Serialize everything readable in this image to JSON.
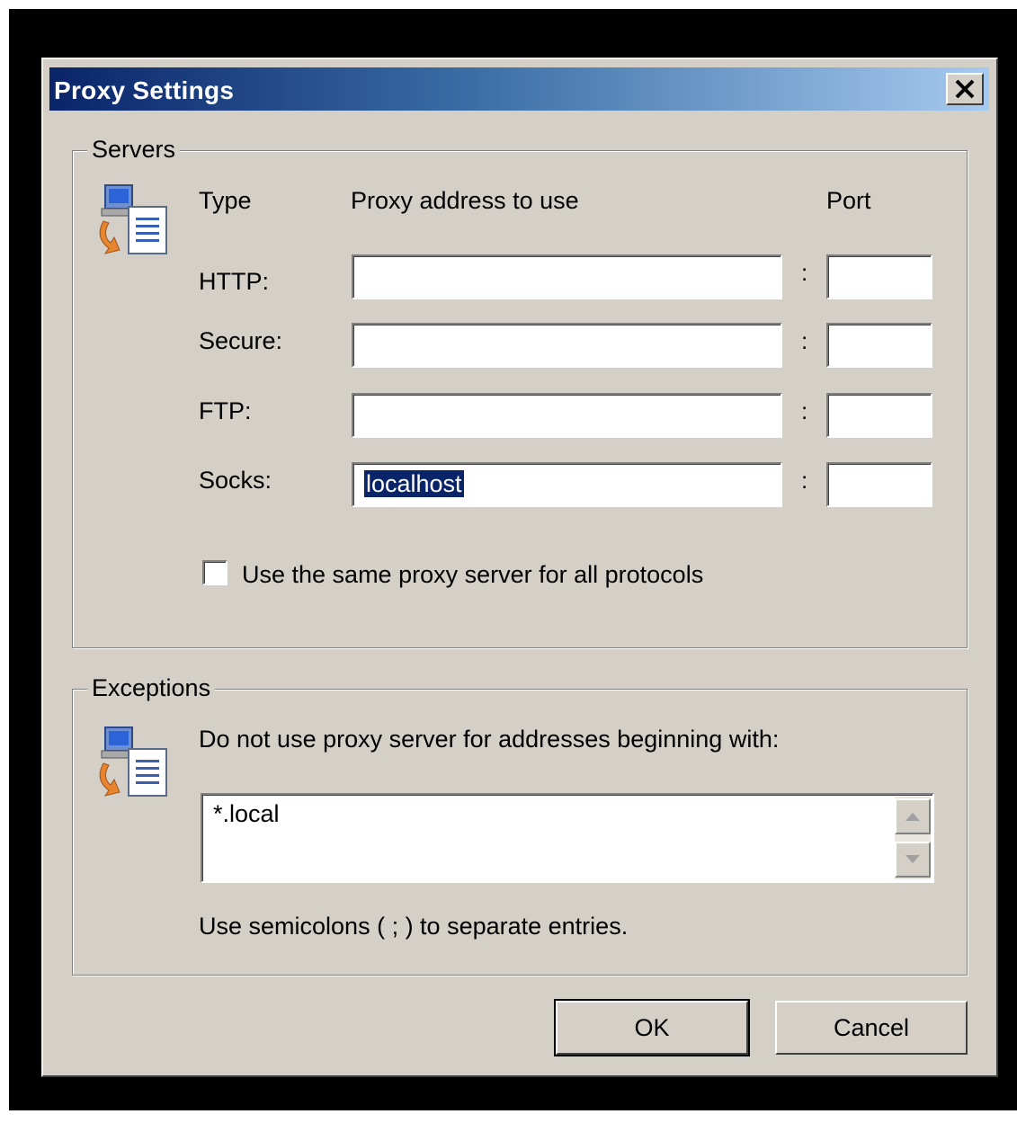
{
  "dialog": {
    "title": "Proxy Settings",
    "close_glyph": "✕"
  },
  "servers": {
    "legend": "Servers",
    "icon": "network-computer-icon",
    "headers": {
      "type": "Type",
      "address": "Proxy address to use",
      "port": "Port"
    },
    "rows": [
      {
        "label": "HTTP:",
        "address": "",
        "port": "",
        "colon": ":"
      },
      {
        "label": "Secure:",
        "address": "",
        "port": "",
        "colon": ":"
      },
      {
        "label": "FTP:",
        "address": "",
        "port": "",
        "colon": ":"
      },
      {
        "label": "Socks:",
        "address": "localhost",
        "port": "",
        "colon": ":"
      }
    ],
    "same_proxy_checkbox": {
      "label": "Use the same proxy server for all protocols",
      "checked": false
    }
  },
  "exceptions": {
    "legend": "Exceptions",
    "icon": "network-computer-icon",
    "instruction": "Do not use proxy server for addresses beginning with:",
    "value": "*.local",
    "hint": "Use semicolons ( ; ) to separate entries."
  },
  "buttons": {
    "ok": "OK",
    "cancel": "Cancel"
  },
  "colors": {
    "dialog_bg": "#d4d0c8",
    "title_gradient_start": "#0a246a",
    "title_gradient_end": "#a6caf0",
    "selection": "#0a246a"
  }
}
